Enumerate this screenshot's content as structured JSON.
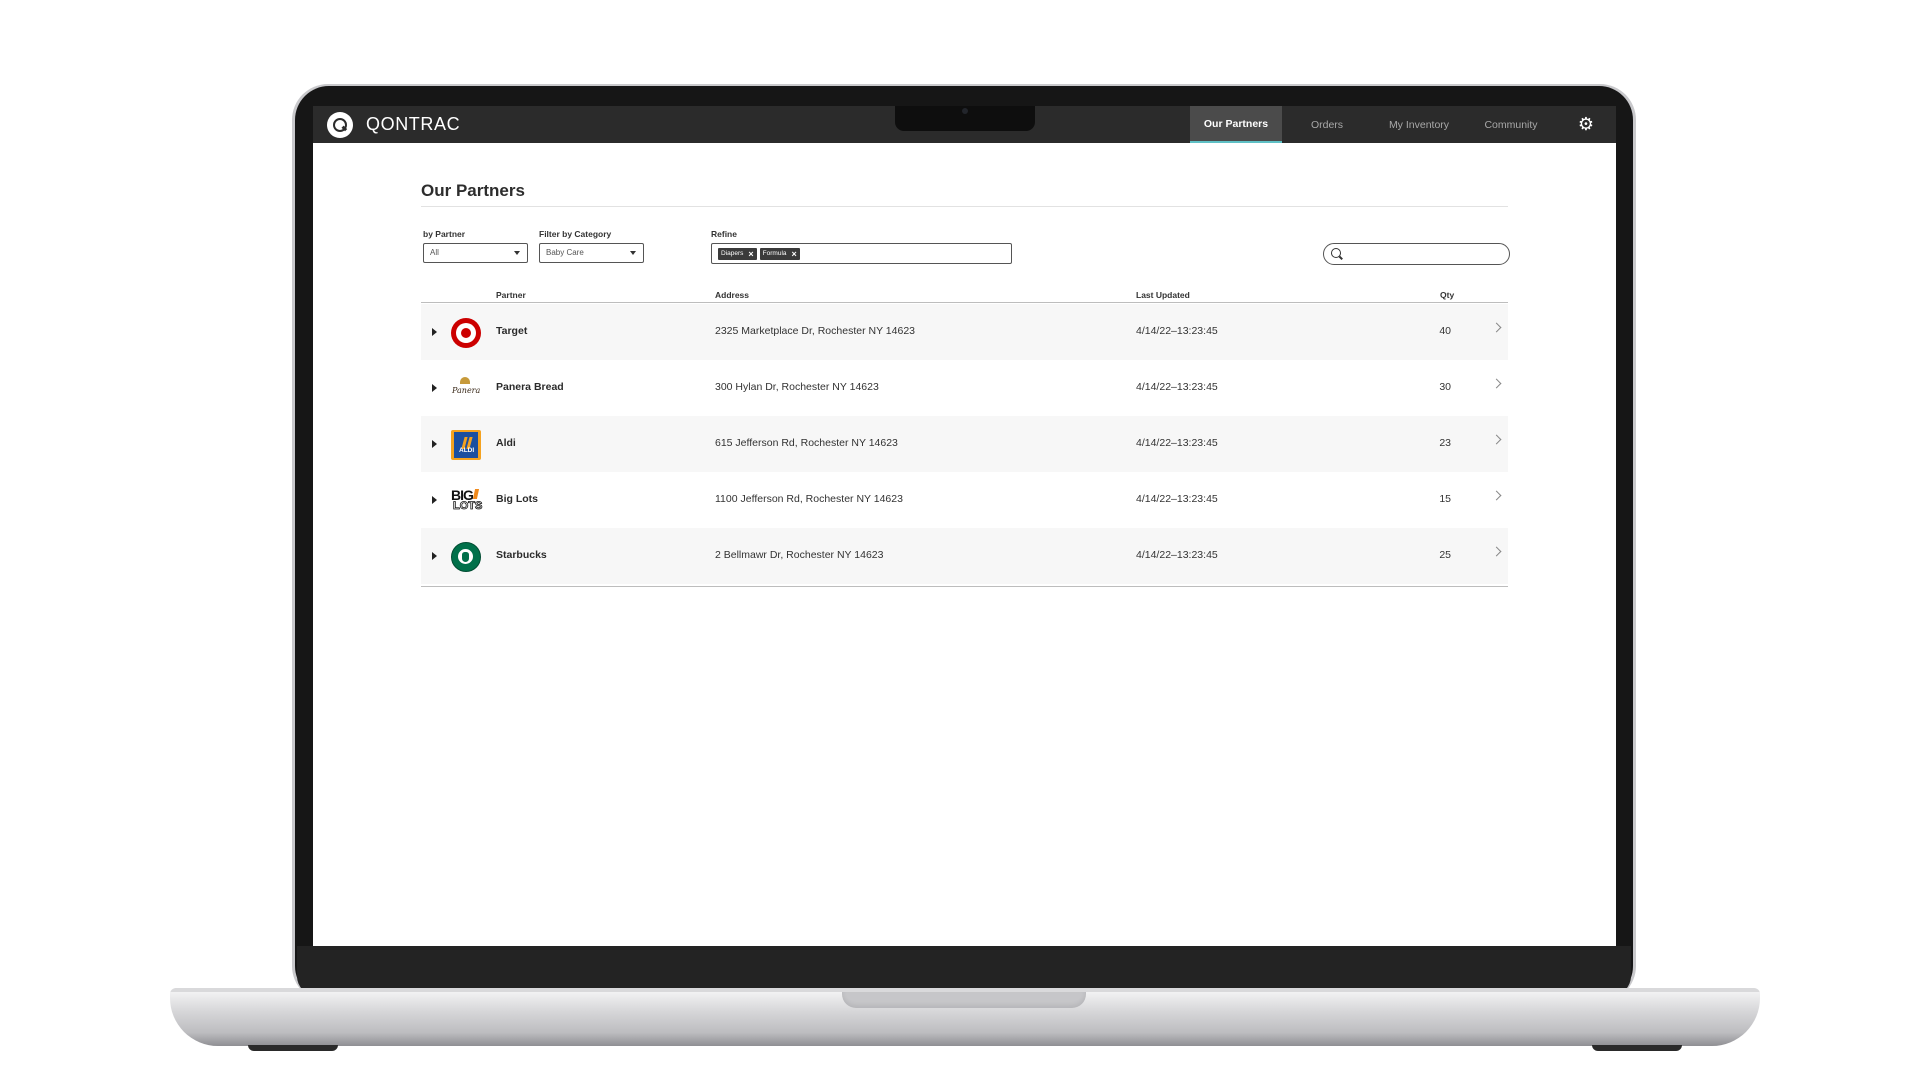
{
  "app": {
    "brand": "QONTRAC"
  },
  "nav": {
    "items": [
      {
        "label": "Our Partners",
        "active": true
      },
      {
        "label": "Orders",
        "active": false
      },
      {
        "label": "My Inventory",
        "active": false
      },
      {
        "label": "Community",
        "active": false
      }
    ],
    "settings_icon": "gear-icon"
  },
  "page": {
    "title": "Our Partners"
  },
  "filters": {
    "partner": {
      "label": "by Partner",
      "value": "All"
    },
    "category": {
      "label": "Filter by Category",
      "value": "Baby Care"
    },
    "refine": {
      "label": "Refine",
      "chips": [
        "Diapers",
        "Formula"
      ]
    },
    "search": {
      "value": ""
    }
  },
  "table": {
    "headers": {
      "partner": "Partner",
      "address": "Address",
      "last_updated": "Last Updated",
      "qty": "Qty"
    },
    "rows": [
      {
        "name": "Target",
        "logo": "target-logo",
        "address": "2325 Marketplace Dr, Rochester NY 14623",
        "last_updated": "4/14/22–13:23:45",
        "qty": "40"
      },
      {
        "name": "Panera Bread",
        "logo": "panera-logo",
        "address": "300 Hylan Dr, Rochester NY 14623",
        "last_updated": "4/14/22–13:23:45",
        "qty": "30"
      },
      {
        "name": "Aldi",
        "logo": "aldi-logo",
        "address": "615 Jefferson Rd, Rochester NY 14623",
        "last_updated": "4/14/22–13:23:45",
        "qty": "23"
      },
      {
        "name": "Big Lots",
        "logo": "big-lots-logo",
        "address": "1100 Jefferson Rd, Rochester NY 14623",
        "last_updated": "4/14/22–13:23:45",
        "qty": "15"
      },
      {
        "name": "Starbucks",
        "logo": "starbucks-logo",
        "address": "2 Bellmawr Dr, Rochester NY 14623",
        "last_updated": "4/14/22–13:23:45",
        "qty": "25"
      }
    ]
  },
  "logo_text": {
    "panera": "Panera",
    "aldi": "ALDI",
    "biglots_big": "BIG",
    "biglots_lots": "LOTS"
  },
  "colors": {
    "nav_bg": "#2b2b2b",
    "active_tab_bg": "#4b4b4b",
    "active_tab_underline": "#5fc0c5",
    "target_red": "#cc0000",
    "starbucks_green": "#00704a",
    "aldi_blue": "#1b4fa0"
  }
}
